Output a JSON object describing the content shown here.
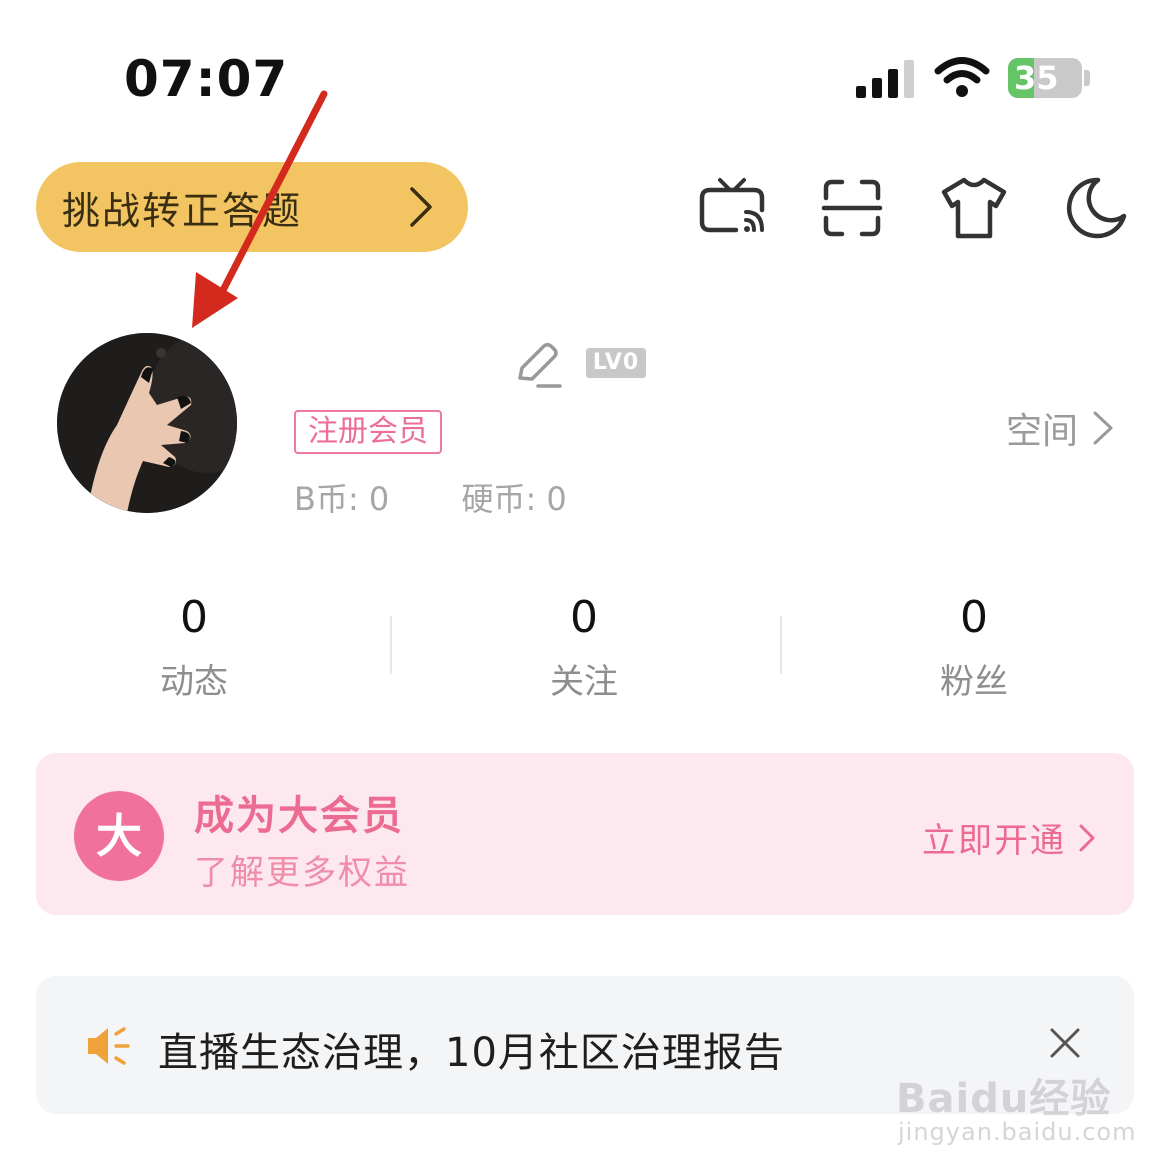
{
  "status_bar": {
    "time": "07:07",
    "battery": "35",
    "battery_level": 0.35
  },
  "header": {
    "challenge_label": "挑战转正答题",
    "icons": [
      "tv-cast-icon",
      "scan-icon",
      "tshirt-icon",
      "moon-icon"
    ]
  },
  "profile": {
    "level": "LV0",
    "member_tag": "注册会员",
    "space_label": "空间",
    "b_coins": "B币: 0",
    "hard_coins": "硬币: 0"
  },
  "stats": [
    {
      "value": "0",
      "label": "动态"
    },
    {
      "value": "0",
      "label": "关注"
    },
    {
      "value": "0",
      "label": "粉丝"
    }
  ],
  "vip": {
    "badge": "大",
    "title": "成为大会员",
    "subtitle": "了解更多权益",
    "action": "立即开通"
  },
  "notice": {
    "text": "直播生态治理，10月社区治理报告"
  },
  "watermark": {
    "logo": "Baidu经验",
    "url": "jingyan.baidu.com"
  },
  "colors": {
    "pill": "#f3c462",
    "pink": "#ec6b93",
    "vip_bg": "#fde8ef",
    "notice_bg": "#f4f5f7",
    "speaker": "#f0a23a",
    "annotation_arrow": "#d42a1e"
  }
}
